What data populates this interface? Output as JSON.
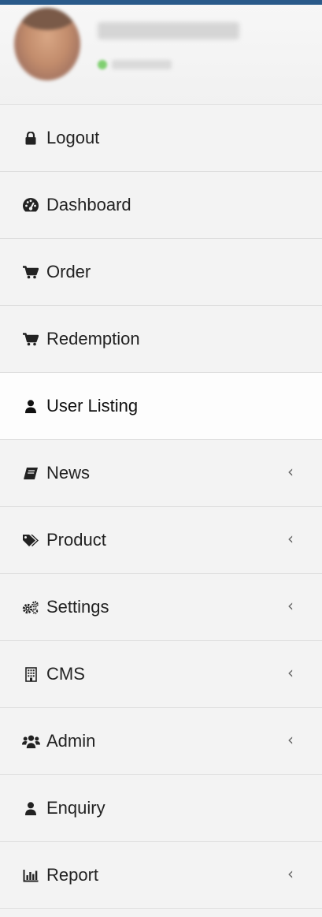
{
  "sidebar": {
    "items": [
      {
        "label": "Logout",
        "icon": "lock-icon",
        "has_children": false,
        "active": false
      },
      {
        "label": "Dashboard",
        "icon": "dashboard-icon",
        "has_children": false,
        "active": false
      },
      {
        "label": "Order",
        "icon": "cart-icon",
        "has_children": false,
        "active": false
      },
      {
        "label": "Redemption",
        "icon": "cart-icon",
        "has_children": false,
        "active": false
      },
      {
        "label": "User Listing",
        "icon": "user-icon",
        "has_children": false,
        "active": true
      },
      {
        "label": "News",
        "icon": "book-icon",
        "has_children": true,
        "active": false
      },
      {
        "label": "Product",
        "icon": "tags-icon",
        "has_children": true,
        "active": false
      },
      {
        "label": "Settings",
        "icon": "gears-icon",
        "has_children": true,
        "active": false
      },
      {
        "label": "CMS",
        "icon": "building-icon",
        "has_children": true,
        "active": false
      },
      {
        "label": "Admin",
        "icon": "users-icon",
        "has_children": true,
        "active": false
      },
      {
        "label": "Enquiry",
        "icon": "user-icon",
        "has_children": false,
        "active": false
      },
      {
        "label": "Report",
        "icon": "bar-chart-icon",
        "has_children": true,
        "active": false
      }
    ]
  },
  "colors": {
    "topbar": "#2a5a8a",
    "sidebar_bg": "#f3f3f3",
    "active_bg": "#fdfdfd",
    "divider": "#dedede",
    "text": "#222222",
    "status_online": "#7fcf70"
  },
  "chevron_glyph": "‹"
}
